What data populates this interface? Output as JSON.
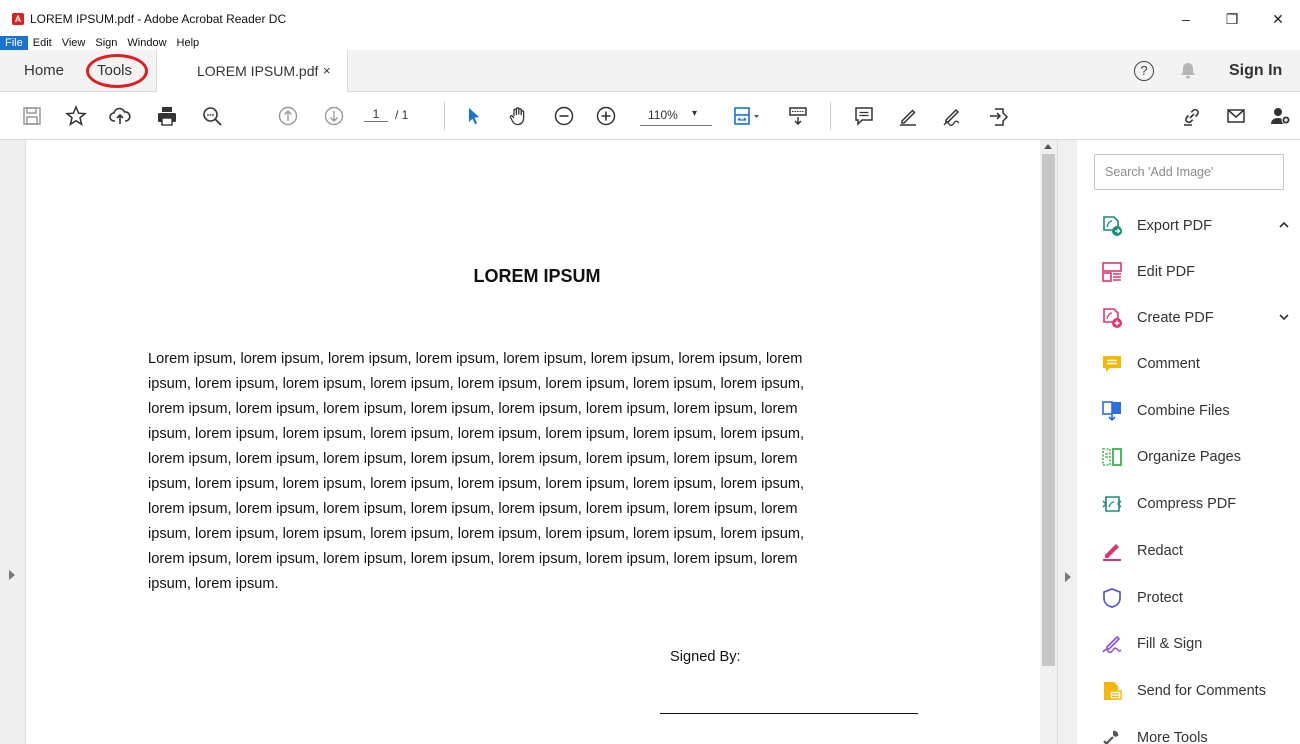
{
  "window": {
    "title": "LOREM IPSUM.pdf - Adobe Acrobat Reader DC",
    "minimize": "–",
    "maximize": "❐",
    "close": "✕"
  },
  "menu": [
    "File",
    "Edit",
    "View",
    "Sign",
    "Window",
    "Help"
  ],
  "tabs": {
    "home": "Home",
    "tools": "Tools",
    "document": "LOREM IPSUM.pdf",
    "document_close": "×",
    "sign_in": "Sign In",
    "help": "?"
  },
  "toolbar": {
    "page_current": "1",
    "page_total": "/ 1",
    "zoom": "110%",
    "zoom_caret": "▾"
  },
  "document": {
    "title": "LOREM IPSUM",
    "body_lines": [
      "Lorem ipsum, lorem ipsum, lorem ipsum, lorem ipsum, lorem ipsum, lorem ipsum, lorem ipsum, lorem",
      "ipsum, lorem ipsum, lorem ipsum, lorem ipsum, lorem ipsum, lorem ipsum, lorem ipsum, lorem ipsum,",
      "lorem ipsum, lorem ipsum, lorem ipsum, lorem ipsum, lorem ipsum, lorem ipsum, lorem ipsum, lorem",
      "ipsum, lorem ipsum, lorem ipsum, lorem ipsum, lorem ipsum, lorem ipsum, lorem ipsum, lorem ipsum,",
      "lorem ipsum, lorem ipsum, lorem ipsum, lorem ipsum, lorem ipsum, lorem ipsum, lorem ipsum, lorem",
      "ipsum, lorem ipsum, lorem ipsum, lorem ipsum, lorem ipsum, lorem ipsum, lorem ipsum, lorem ipsum,",
      "lorem ipsum, lorem ipsum, lorem ipsum, lorem ipsum, lorem ipsum, lorem ipsum, lorem ipsum, lorem",
      "ipsum, lorem ipsum, lorem ipsum, lorem ipsum, lorem ipsum, lorem ipsum, lorem ipsum, lorem ipsum,",
      "lorem ipsum, lorem ipsum, lorem ipsum, lorem ipsum, lorem ipsum, lorem ipsum, lorem ipsum, lorem",
      "ipsum, lorem ipsum."
    ],
    "signed_by": "Signed By:"
  },
  "tools_pane": {
    "search_placeholder": "Search 'Add Image'",
    "items": [
      {
        "label": "Export PDF",
        "icon": "export-pdf-icon",
        "color": "#1a8c7a"
      },
      {
        "label": "Edit PDF",
        "icon": "edit-pdf-icon",
        "color": "#e0356b"
      },
      {
        "label": "Create PDF",
        "icon": "create-pdf-icon",
        "color": "#e0356b"
      },
      {
        "label": "Comment",
        "icon": "comment-icon",
        "color": "#f5b700"
      },
      {
        "label": "Combine Files",
        "icon": "combine-files-icon",
        "color": "#2a6fdb"
      },
      {
        "label": "Organize Pages",
        "icon": "organize-pages-icon",
        "color": "#3fae49"
      },
      {
        "label": "Compress PDF",
        "icon": "compress-pdf-icon",
        "color": "#1a8c7a"
      },
      {
        "label": "Redact",
        "icon": "redact-icon",
        "color": "#e0356b"
      },
      {
        "label": "Protect",
        "icon": "protect-icon",
        "color": "#5a5fd6"
      },
      {
        "label": "Fill & Sign",
        "icon": "fill-sign-icon",
        "color": "#8a4fd6"
      },
      {
        "label": "Send for Comments",
        "icon": "send-for-comments-icon",
        "color": "#f5b700"
      },
      {
        "label": "More Tools",
        "icon": "more-tools-icon",
        "color": "#555555"
      }
    ]
  },
  "colors": {
    "accent": "#1a73d1",
    "annotation_circle": "#e01e1e"
  }
}
